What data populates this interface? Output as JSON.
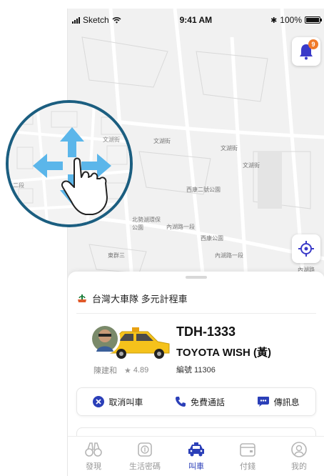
{
  "status_bar": {
    "carrier": "Sketch",
    "time": "9:41 AM",
    "battery": "100%"
  },
  "notifications": {
    "count": "9"
  },
  "map": {
    "labels": [
      "文湖街",
      "文湖街",
      "西康二號公園",
      "文湖街",
      "北勢湖環保公園",
      "東群三",
      "西康公園",
      "內湖路一段",
      "內湖路一段",
      "內湖路"
    ],
    "magnifier_labels": [
      "文湖街",
      "二段"
    ]
  },
  "ride": {
    "company": "台灣大車隊 多元計程車",
    "driver_name": "陳建和",
    "rating": "4.89",
    "plate": "TDH-1333",
    "car_model": "TOYOTA WISH (黃)",
    "car_number": "編號 11306"
  },
  "actions": {
    "cancel": "取消叫車",
    "call": "免費通話",
    "message": "傳訊息"
  },
  "tabs": [
    {
      "label": "發現",
      "icon": "binoculars-icon"
    },
    {
      "label": "生活密碼",
      "icon": "coin-icon"
    },
    {
      "label": "叫車",
      "icon": "taxi-icon"
    },
    {
      "label": "付錢",
      "icon": "wallet-icon"
    },
    {
      "label": "我的",
      "icon": "user-icon"
    }
  ],
  "colors": {
    "accent": "#2b3fb8",
    "badge": "#f07a2a",
    "bell": "#3a3ac8",
    "taxi_yellow": "#f5c21b",
    "ring": "#1b5e80"
  }
}
